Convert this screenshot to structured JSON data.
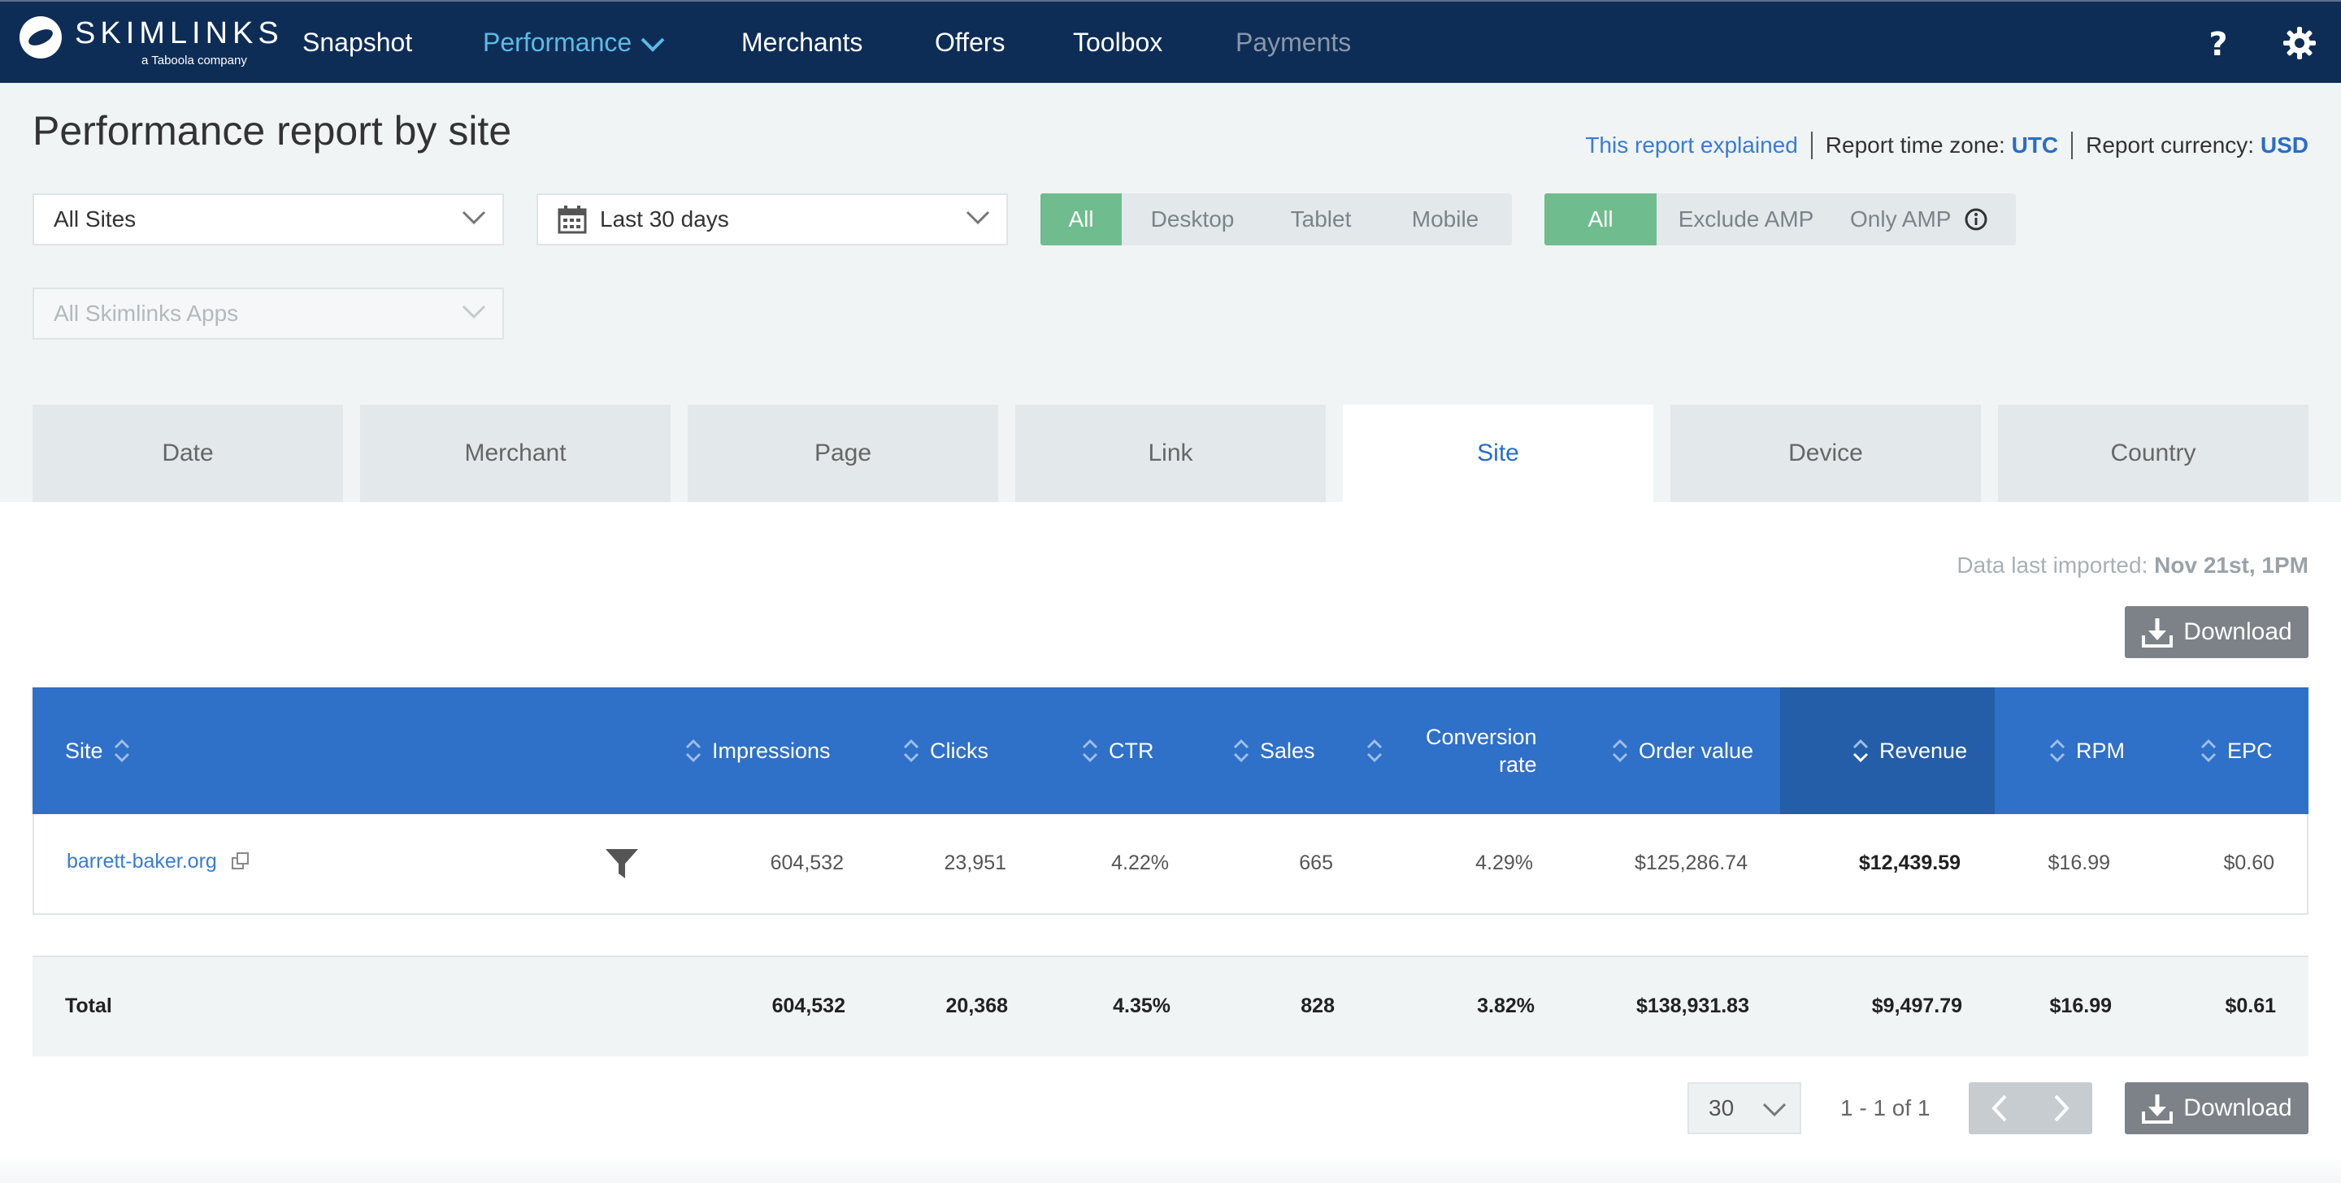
{
  "nav": {
    "brand": "SKIMLINKS",
    "brand_sub": "a Taboola company",
    "items": [
      {
        "label": "Snapshot",
        "state": "normal"
      },
      {
        "label": "Performance",
        "state": "active"
      },
      {
        "label": "Merchants",
        "state": "normal"
      },
      {
        "label": "Offers",
        "state": "normal"
      },
      {
        "label": "Toolbox",
        "state": "normal"
      },
      {
        "label": "Payments",
        "state": "disabled"
      }
    ],
    "help_icon": "question-mark-icon",
    "settings_icon": "gear-icon"
  },
  "header": {
    "title": "Performance report by site",
    "report_explained": "This report explained",
    "timezone_label": "Report time zone:",
    "timezone_value": "UTC",
    "currency_label": "Report currency:",
    "currency_value": "USD"
  },
  "filters": {
    "sites": "All Sites",
    "date_range": "Last 30 days",
    "apps": "All Skimlinks Apps",
    "device": {
      "options": [
        "All",
        "Desktop",
        "Tablet",
        "Mobile"
      ],
      "selected": "All"
    },
    "amp": {
      "options": [
        "All",
        "Exclude AMP",
        "Only AMP"
      ],
      "selected": "All"
    }
  },
  "tabs": [
    {
      "label": "Date"
    },
    {
      "label": "Merchant"
    },
    {
      "label": "Page"
    },
    {
      "label": "Link"
    },
    {
      "label": "Site",
      "active": true
    },
    {
      "label": "Device"
    },
    {
      "label": "Country"
    }
  ],
  "imported": {
    "label": "Data last imported:",
    "value": "Nov 21st, 1PM"
  },
  "download_label": "Download",
  "table": {
    "columns": {
      "site": "Site",
      "impressions": "Impressions",
      "clicks": "Clicks",
      "ctr": "CTR",
      "sales": "Sales",
      "conversion_1": "Conversion",
      "conversion_2": "rate",
      "order_value": "Order value",
      "revenue": "Revenue",
      "rpm": "RPM",
      "epc": "EPC"
    },
    "rows": [
      {
        "site": "barrett-baker.org",
        "impressions": "604,532",
        "clicks": "23,951",
        "ctr": "4.22%",
        "sales": "665",
        "conversion": "4.29%",
        "order_value": "$125,286.74",
        "revenue": "$12,439.59",
        "rpm": "$16.99",
        "epc": "$0.60"
      }
    ],
    "total": {
      "label": "Total",
      "impressions": "604,532",
      "clicks": "20,368",
      "ctr": "4.35%",
      "sales": "828",
      "conversion": "3.82%",
      "order_value": "$138,931.83",
      "revenue": "$9,497.79",
      "rpm": "$16.99",
      "epc": "$0.61"
    }
  },
  "pagination": {
    "per_page": "30",
    "range": "1 - 1 of 1"
  },
  "colors": {
    "nav_bg": "#0e2d56",
    "accent": "#2f70c8",
    "toggle_on": "#6fbd8e",
    "active_nav": "#5bbbe4"
  }
}
